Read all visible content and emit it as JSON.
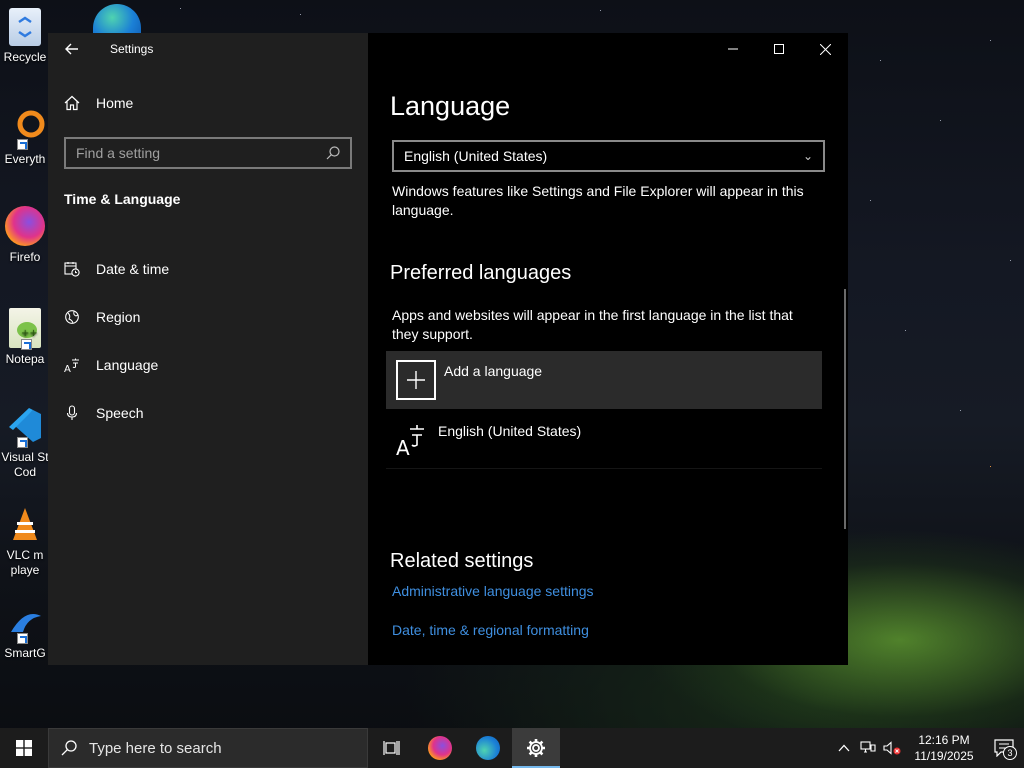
{
  "desktop": {
    "icons": [
      {
        "label": "Recycle",
        "icon": "recycle-bin-icon"
      },
      {
        "label": "Everyth",
        "icon": "everything-search-icon"
      },
      {
        "label": "Firefo",
        "icon": "firefox-icon"
      },
      {
        "label": "Notepa",
        "icon": "notepad-plus-plus-icon"
      },
      {
        "label": "Visual St Cod",
        "icon": "vscode-icon"
      },
      {
        "label": "VLC m playe",
        "icon": "vlc-icon"
      },
      {
        "label": "SmartG",
        "icon": "smartgit-icon"
      }
    ]
  },
  "window": {
    "app_title": "Settings",
    "controls": {
      "minimize": "minimize-icon",
      "maximize": "maximize-icon",
      "close": "close-icon"
    }
  },
  "sidebar": {
    "home_label": "Home",
    "search_placeholder": "Find a setting",
    "section_label": "Time & Language",
    "items": [
      {
        "label": "Date & time",
        "icon": "calendar-clock-icon"
      },
      {
        "label": "Region",
        "icon": "globe-icon"
      },
      {
        "label": "Language",
        "icon": "language-icon"
      },
      {
        "label": "Speech",
        "icon": "microphone-icon"
      }
    ]
  },
  "main": {
    "title": "Language",
    "display_language": "English (United States)",
    "display_language_desc": "Windows features like Settings and File Explorer will appear in this language.",
    "preferred_heading": "Preferred languages",
    "preferred_desc": "Apps and websites will appear in the first language in the list that they support.",
    "add_language_label": "Add a language",
    "languages": [
      {
        "label": "English (United States)"
      }
    ],
    "related_heading": "Related settings",
    "related_links": [
      "Administrative language settings",
      "Date, time & regional formatting"
    ]
  },
  "taskbar": {
    "search_placeholder": "Type here to search",
    "apps": [
      "task-view-icon",
      "firefox-icon",
      "edge-icon",
      "settings-icon"
    ],
    "active_app": "settings-icon",
    "time": "12:16 PM",
    "date": "11/19/2025",
    "notification_count": "3"
  },
  "colors": {
    "accent_link": "#3f8fe0",
    "sidebar_bg": "#1f1f1f",
    "content_bg": "#000000",
    "taskbar_bg": "#1c1c1c"
  }
}
